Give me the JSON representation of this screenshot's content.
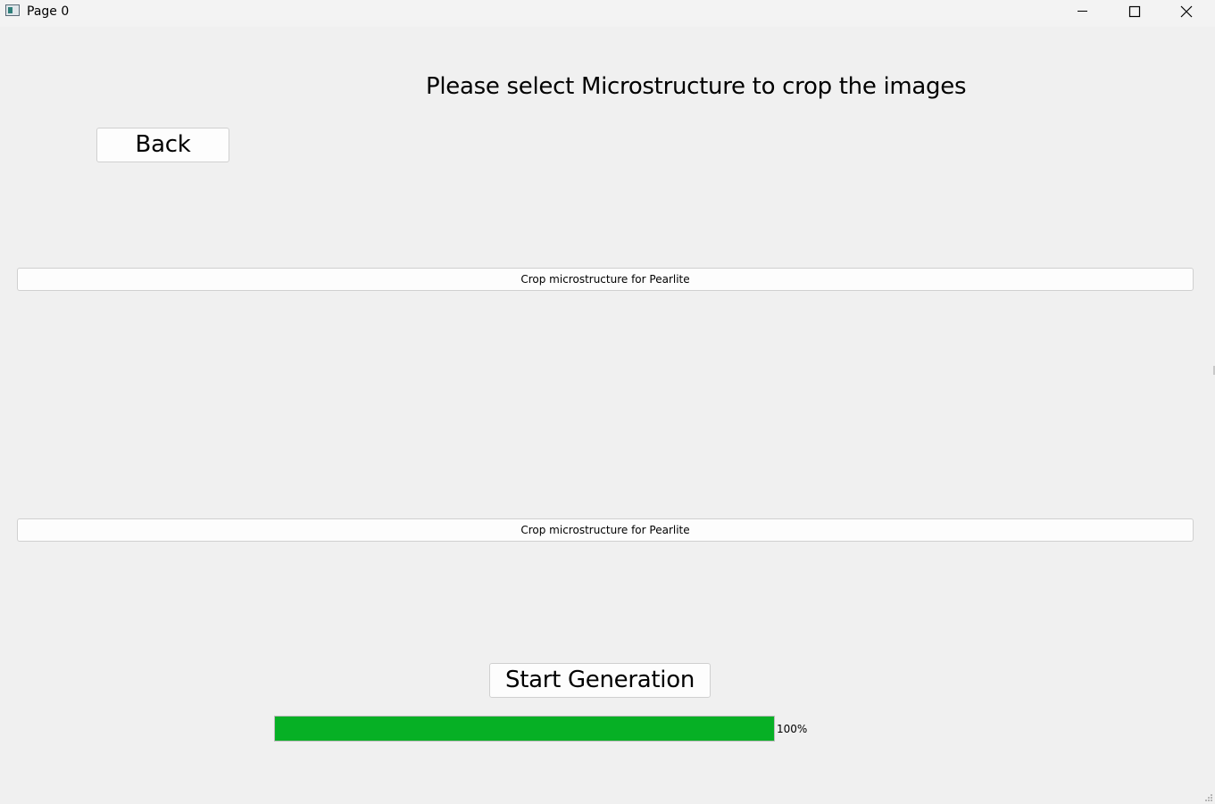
{
  "window": {
    "title": "Page 0",
    "icon": "app-window-icon",
    "controls": [
      "minimize-icon",
      "maximize-icon",
      "close-icon"
    ]
  },
  "main": {
    "heading": "Please select Microstructure to crop the images",
    "back_label": "Back",
    "crop_buttons": [
      {
        "label": "Crop microstructure for Pearlite"
      },
      {
        "label": "Crop microstructure for Pearlite"
      }
    ],
    "start_label": "Start Generation",
    "progress": {
      "value": 100,
      "text": "100%",
      "color": "#06b025"
    }
  }
}
